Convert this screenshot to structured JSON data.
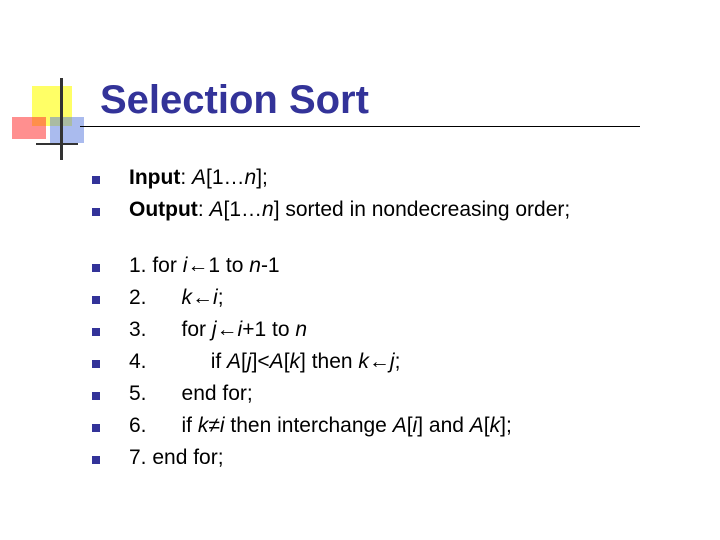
{
  "slide": {
    "title": "Selection Sort",
    "lines": [
      {
        "label": "Input",
        "colon": ": ",
        "a": "A",
        "rest": "[1…",
        "n": "n",
        "end": "];"
      },
      {
        "label": "Output",
        "colon": ": ",
        "a": "A",
        "rest": "[1…",
        "n": "n",
        "end": "] sorted in nondecreasing order;"
      }
    ],
    "algo": [
      {
        "parts": [
          {
            "t": "1. for ",
            "s": ""
          },
          {
            "t": "i",
            "s": "i"
          },
          {
            "t": "←1 to ",
            "s": ""
          },
          {
            "t": "n",
            "s": "i"
          },
          {
            "t": "-1",
            "s": ""
          }
        ]
      },
      {
        "parts": [
          {
            "t": "2.      ",
            "s": ""
          },
          {
            "t": "k",
            "s": "i"
          },
          {
            "t": "←",
            "s": ""
          },
          {
            "t": "i",
            "s": "i"
          },
          {
            "t": ";",
            "s": ""
          }
        ]
      },
      {
        "parts": [
          {
            "t": "3.      for ",
            "s": ""
          },
          {
            "t": "j",
            "s": "i"
          },
          {
            "t": "←",
            "s": ""
          },
          {
            "t": "i",
            "s": "i"
          },
          {
            "t": "+1 to ",
            "s": ""
          },
          {
            "t": "n",
            "s": "i"
          }
        ]
      },
      {
        "parts": [
          {
            "t": "4.           if ",
            "s": ""
          },
          {
            "t": "A",
            "s": "i"
          },
          {
            "t": "[",
            "s": ""
          },
          {
            "t": "j",
            "s": "i"
          },
          {
            "t": "]<",
            "s": ""
          },
          {
            "t": "A",
            "s": "i"
          },
          {
            "t": "[",
            "s": ""
          },
          {
            "t": "k",
            "s": "i"
          },
          {
            "t": "] then ",
            "s": ""
          },
          {
            "t": "k",
            "s": "i"
          },
          {
            "t": "←",
            "s": ""
          },
          {
            "t": "j",
            "s": "i"
          },
          {
            "t": ";",
            "s": ""
          }
        ]
      },
      {
        "parts": [
          {
            "t": "5.      end for;",
            "s": ""
          }
        ]
      },
      {
        "parts": [
          {
            "t": "6.      if ",
            "s": ""
          },
          {
            "t": "k",
            "s": "i"
          },
          {
            "t": "≠",
            "s": ""
          },
          {
            "t": "i",
            "s": "i"
          },
          {
            "t": " then interchange ",
            "s": ""
          },
          {
            "t": "A",
            "s": "i"
          },
          {
            "t": "[",
            "s": ""
          },
          {
            "t": "i",
            "s": "i"
          },
          {
            "t": "] and ",
            "s": ""
          },
          {
            "t": "A",
            "s": "i"
          },
          {
            "t": "[",
            "s": ""
          },
          {
            "t": "k",
            "s": "i"
          },
          {
            "t": "];",
            "s": ""
          }
        ]
      },
      {
        "parts": [
          {
            "t": "7. end for;",
            "s": ""
          }
        ]
      }
    ]
  },
  "colors": {
    "title": "#333399",
    "bullet": "#333399",
    "text": "#000000"
  }
}
